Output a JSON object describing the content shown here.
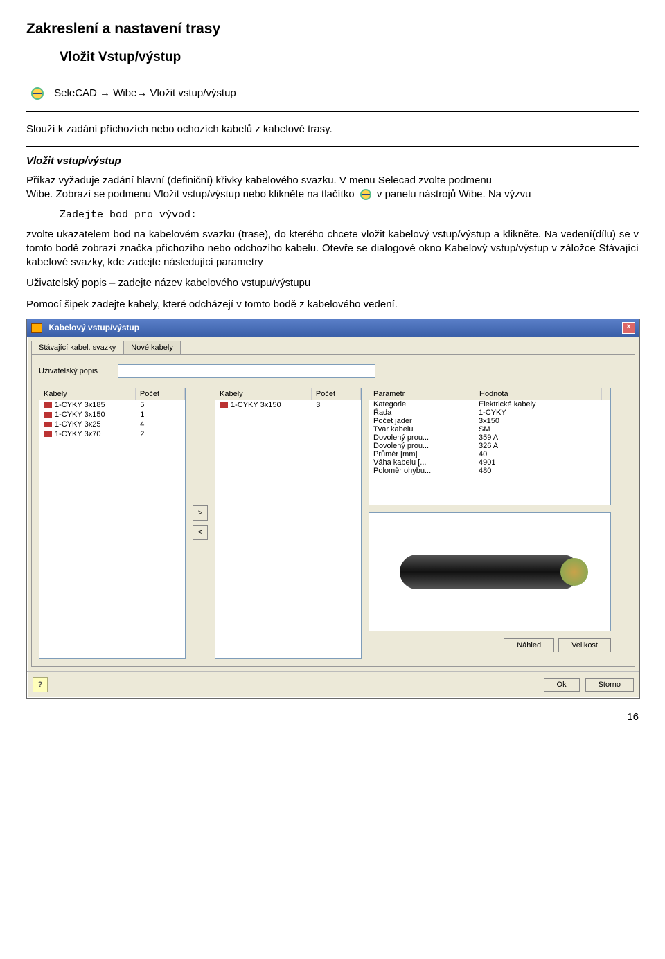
{
  "headings": {
    "h1": "Zakreslení a nastavení trasy",
    "h2": "Vložit Vstup/výstup"
  },
  "nav_path": "SeleCAD → Wibe→ Vložit vstup/výstup",
  "desc": "Slouží k zadání příchozích nebo ochozích kabelů z kabelové trasy.",
  "section_italic": "Vložit vstup/výstup",
  "para1a": "Příkaz vyžaduje zadání hlavní (definiční) křivky kabelového svazku. V menu Selecad zvolte podmenu",
  "para1b": "Wibe. Zobrazí se podmenu Vložit vstup/výstup nebo klikněte na tlačítko ",
  "para1c": " v panelu nástrojů Wibe. Na výzvu",
  "mono": "Zadejte bod pro vývod:",
  "para2": "zvolte ukazatelem bod na kabelovém svazku (trase), do kterého chcete vložit kabelový vstup/výstup a klikněte. Na vedení(dílu) se v tomto bodě zobrazí značka příchozího nebo odchozího kabelu. Otevře se dialogové okno Kabelový vstup/výstup v záložce Stávající kabelové svazky, kde zadejte následující parametry",
  "para3": "Uživatelský popis – zadejte název kabelového vstupu/výstupu",
  "para4": "Pomocí šipek zadejte kabely, které odcházejí v tomto bodě z kabelového vedení.",
  "dialog": {
    "title": "Kabelový vstup/výstup",
    "tabs": [
      "Stávající kabel. svazky",
      "Nové kabely"
    ],
    "user_label": "Uživatelský popis",
    "left_cols": [
      "Kabely",
      "Počet"
    ],
    "left_rows": [
      [
        "1-CYKY 3x185",
        "5"
      ],
      [
        "1-CYKY 3x150",
        "1"
      ],
      [
        "1-CYKY 3x25",
        "4"
      ],
      [
        "1-CYKY 3x70",
        "2"
      ]
    ],
    "mid_cols": [
      "Kabely",
      "Počet"
    ],
    "mid_rows": [
      [
        "1-CYKY 3x150",
        "3"
      ]
    ],
    "prop_cols": [
      "Parametr",
      "Hodnota"
    ],
    "prop_rows": [
      [
        "Kategorie",
        "Elektrické kabely"
      ],
      [
        "Řada",
        "1-CYKY"
      ],
      [
        "Počet jader",
        "3x150"
      ],
      [
        "Tvar kabelu",
        "SM"
      ],
      [
        "Dovolený prou...",
        "359 A"
      ],
      [
        "Dovolený prou...",
        "326 A"
      ],
      [
        "Průměr [mm]",
        "40"
      ],
      [
        "Váha kabelu [...",
        "4901"
      ],
      [
        "Poloměr ohybu...",
        "480"
      ]
    ],
    "btn_preview": "Náhled",
    "btn_size": "Velikost",
    "btn_ok": "Ok",
    "btn_cancel": "Storno",
    "arrow_right": ">",
    "arrow_left": "<",
    "help": "?"
  },
  "page_number": "16"
}
